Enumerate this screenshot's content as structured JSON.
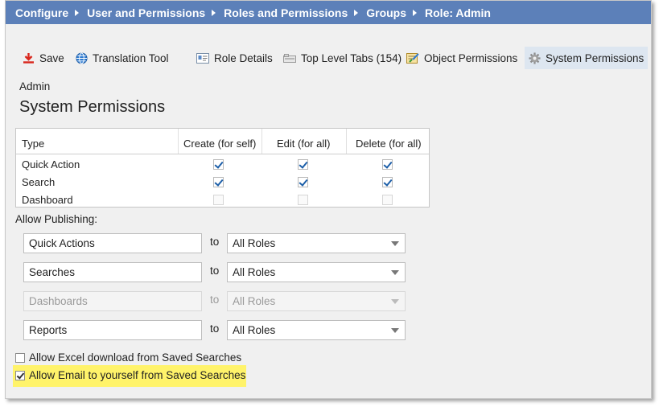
{
  "breadcrumb": [
    "Configure",
    "User and Permissions",
    "Roles and Permissions",
    "Groups",
    "Role: Admin"
  ],
  "toolbar": {
    "save_label": "Save",
    "translation_label": "Translation Tool",
    "role_details_label": "Role Details",
    "top_level_tabs_label": "Top Level Tabs (154)",
    "object_permissions_label": "Object Permissions",
    "system_permissions_label": "System Permissions"
  },
  "subtitle": "Admin",
  "page_title": "System Permissions",
  "permissions_table": {
    "headers": [
      "Type",
      "Create (for self)",
      "Edit (for all)",
      "Delete (for all)"
    ],
    "rows": [
      {
        "type": "Quick Action",
        "create": true,
        "edit": true,
        "delete": true
      },
      {
        "type": "Search",
        "create": true,
        "edit": true,
        "delete": true
      },
      {
        "type": "Dashboard",
        "create": false,
        "edit": false,
        "delete": false
      }
    ]
  },
  "allow_publishing_label": "Allow Publishing:",
  "publishing": [
    {
      "item": "Quick Actions",
      "to": "to",
      "roles": "All Roles",
      "disabled": false
    },
    {
      "item": "Searches",
      "to": "to",
      "roles": "All Roles",
      "disabled": false
    },
    {
      "item": "Dashboards",
      "to": "to",
      "roles": "All Roles",
      "disabled": true
    },
    {
      "item": "Reports",
      "to": "to",
      "roles": "All Roles",
      "disabled": false
    }
  ],
  "options": {
    "excel_download_label": "Allow Excel download from Saved Searches",
    "excel_download_checked": false,
    "email_yourself_label": "Allow Email to yourself from Saved Searches",
    "email_yourself_checked": true
  },
  "colors": {
    "breadcrumb_bg": "#5c80b9",
    "highlight": "#fff36a",
    "check": "#1c5ea8",
    "save_icon": "#d9261c"
  }
}
